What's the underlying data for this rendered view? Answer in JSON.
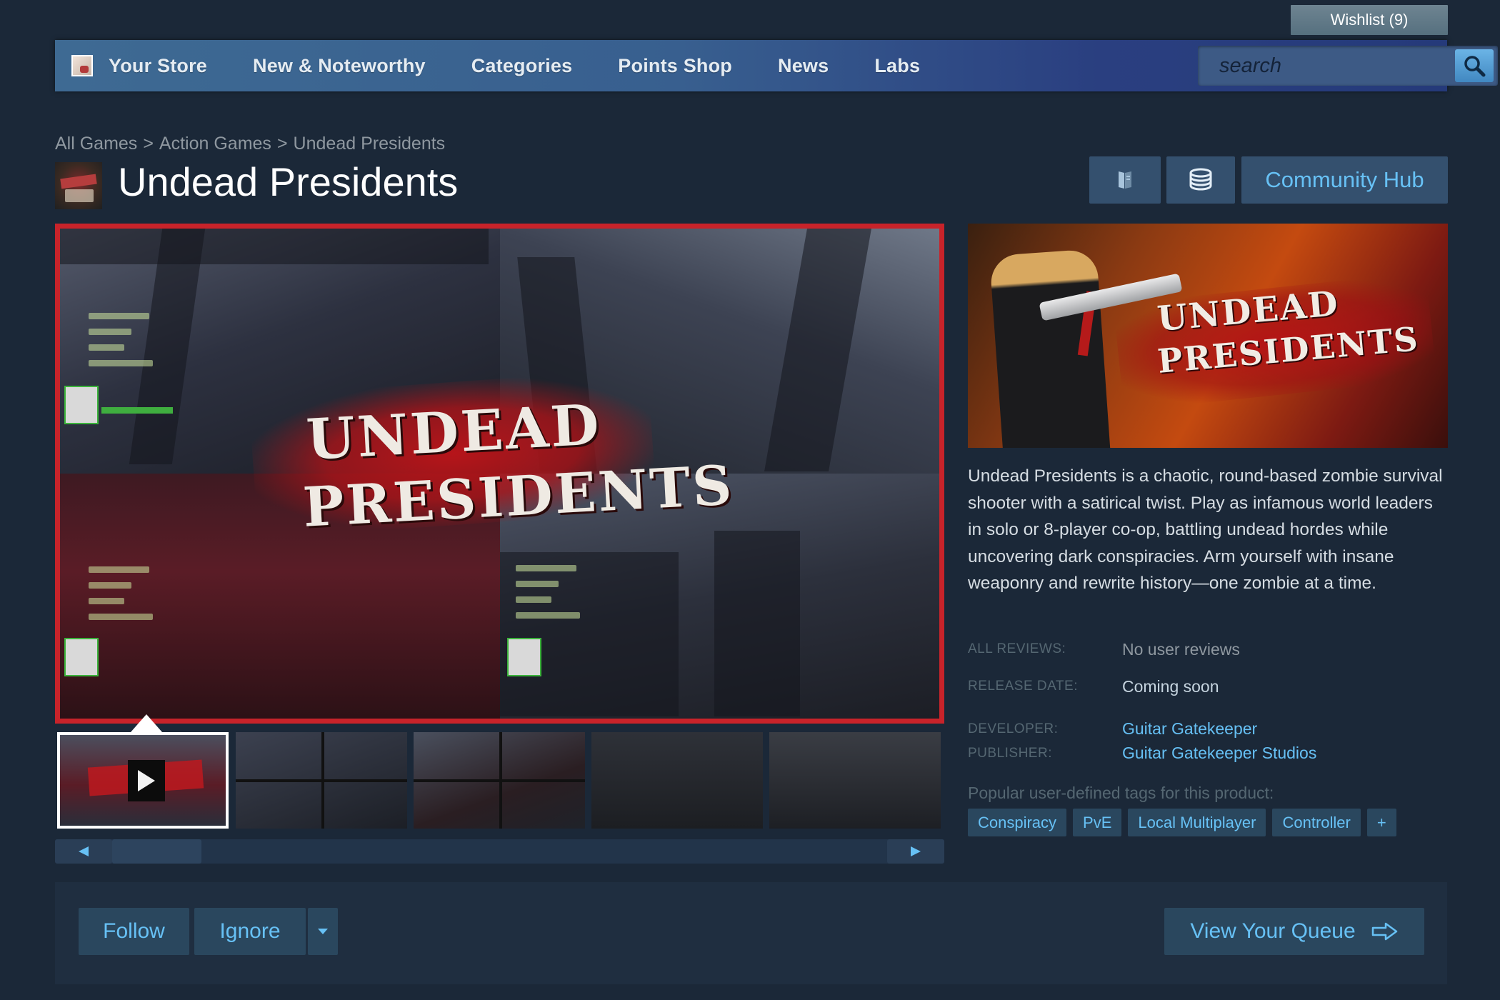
{
  "wishlist": {
    "label": "Wishlist (9)"
  },
  "nav": {
    "items": [
      "Your Store",
      "New & Noteworthy",
      "Categories",
      "Points Shop",
      "News",
      "Labs"
    ],
    "search_placeholder": "search"
  },
  "breadcrumb": {
    "items": [
      "All Games",
      "Action Games",
      "Undead Presidents"
    ],
    "separator": ">"
  },
  "game": {
    "title": "Undead Presidents",
    "logo_line1": "UNDEAD",
    "logo_line2": "PRESIDENTS",
    "description": "Undead Presidents is a chaotic, round-based zombie survival shooter with a satirical twist. Play as infamous world leaders in solo or 8-player co-op, battling undead hordes while uncovering dark conspiracies. Arm yourself with insane weaponry and rewrite history—one zombie at a time."
  },
  "header_buttons": {
    "community_hub": "Community Hub",
    "icon1": "book-icon",
    "icon2": "coins-icon"
  },
  "info": {
    "reviews_label": "ALL REVIEWS:",
    "reviews_value": "No user reviews",
    "release_label": "RELEASE DATE:",
    "release_value": "Coming soon",
    "developer_label": "DEVELOPER:",
    "developer_value": "Guitar Gatekeeper",
    "publisher_label": "PUBLISHER:",
    "publisher_value": "Guitar Gatekeeper Studios"
  },
  "tags": {
    "label": "Popular user-defined tags for this product:",
    "items": [
      "Conspiracy",
      "PvE",
      "Local Multiplayer",
      "Controller",
      "+"
    ]
  },
  "bottom": {
    "follow": "Follow",
    "ignore": "Ignore",
    "view_queue": "View Your Queue"
  },
  "colors": {
    "background": "#1b2838",
    "accent_link": "#66c0f4",
    "media_border": "#c8232a"
  }
}
